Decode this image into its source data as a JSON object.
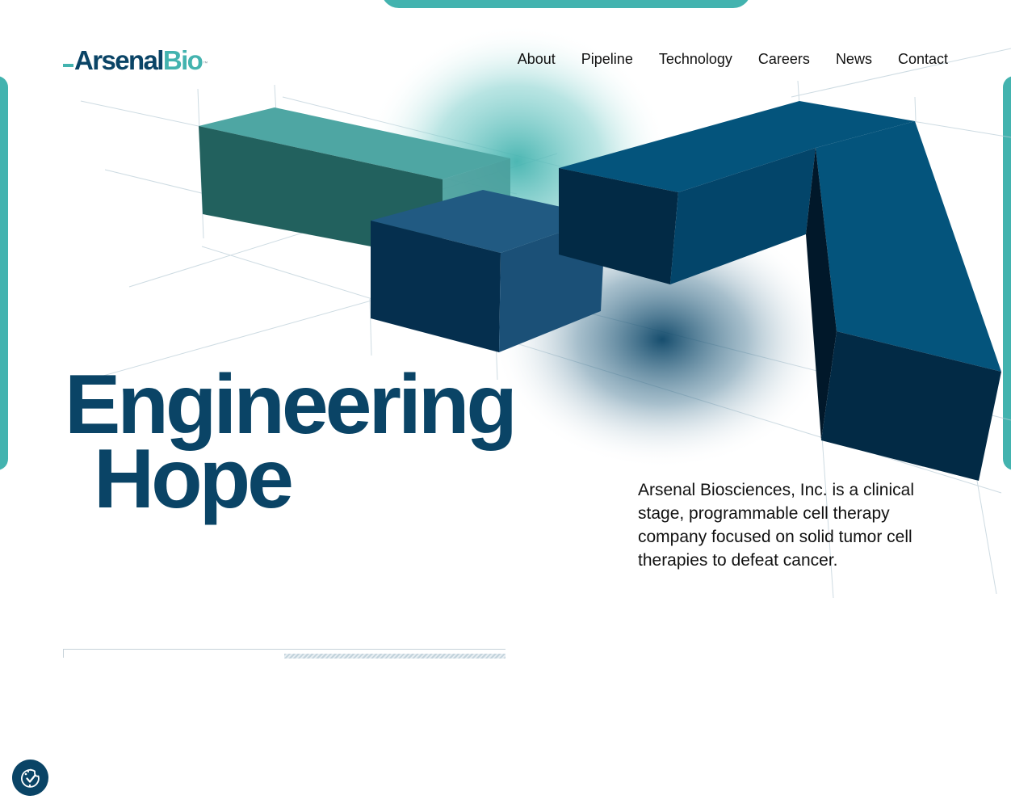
{
  "brand": {
    "logo_primary": "Arsenal",
    "logo_secondary": "Bio",
    "logo_mark": "™",
    "colors": {
      "navy": "#0a4466",
      "teal": "#43b3af",
      "teal_dark": "#22615e",
      "block_blue": "#04547c",
      "block_shadow": "#022a45"
    }
  },
  "nav": {
    "items": [
      {
        "label": "About"
      },
      {
        "label": "Pipeline"
      },
      {
        "label": "Technology"
      },
      {
        "label": "Careers"
      },
      {
        "label": "News"
      },
      {
        "label": "Contact"
      }
    ]
  },
  "hero": {
    "title_line1": "Engineering",
    "title_line2": "Hope",
    "description": "Arsenal Biosciences, Inc. is a clinical stage, programmable cell therapy company focused on solid tumor cell therapies to defeat cancer.",
    "art_icon": "3d-blocks-illustration",
    "slide_progress": 0.5
  },
  "cookie_button": {
    "icon": "cookie-consent-icon"
  }
}
